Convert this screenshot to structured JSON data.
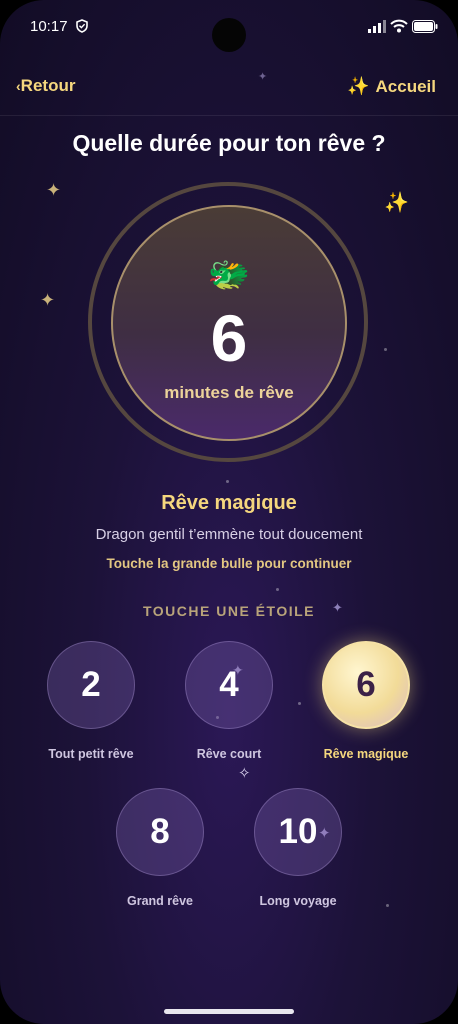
{
  "status_bar": {
    "time": "10:17"
  },
  "nav": {
    "back_label": "Retour",
    "home_label": "Accueil",
    "home_icon": "sparkles-icon"
  },
  "title": "Quelle durée pour ton rêve ?",
  "bubble": {
    "icon": "dragon",
    "value": "6",
    "unit": "minutes de rêve"
  },
  "mode": {
    "title": "Rêve magique",
    "subtitle": "Dragon gentil t’emmène tout doucement",
    "hint": "Touche la grande bulle pour continuer"
  },
  "section_label": "TOUCHE UNE ÉTOILE",
  "options": [
    {
      "value": "2",
      "label": "Tout petit rêve",
      "selected": false
    },
    {
      "value": "4",
      "label": "Rêve court",
      "selected": false
    },
    {
      "value": "6",
      "label": "Rêve magique",
      "selected": true
    },
    {
      "value": "8",
      "label": "Grand rêve",
      "selected": false
    },
    {
      "value": "10",
      "label": "Long voyage",
      "selected": false
    }
  ],
  "colors": {
    "accent_gold": "#f5d77e",
    "background": "#1c1238",
    "selected_text": "#3b2147"
  }
}
